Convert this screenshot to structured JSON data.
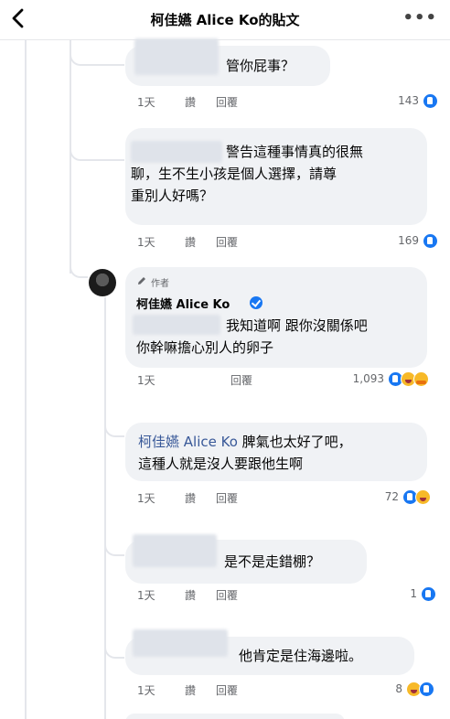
{
  "header": {
    "title": "柯佳嬿 Alice Ko的貼文",
    "more": "•••"
  },
  "actions": {
    "time": "1天",
    "like": "讚",
    "reply": "回覆"
  },
  "author": {
    "tag": "作者",
    "name": "柯佳嬿 Alice Ko"
  },
  "comments": [
    {
      "line1": "管你屁事？",
      "count": "143",
      "reactions": [
        "like"
      ]
    },
    {
      "line1": "警告這種事情真的很無",
      "line2": "聊，生不生小孩是個人選擇，請尊",
      "line3": "重別人好嗎？",
      "count": "169",
      "reactions": [
        "like"
      ]
    },
    {
      "line1": "我知道啊 跟你沒關係吧",
      "line2": "你幹嘛擔心別人的卵子",
      "count": "1,093",
      "reactions": [
        "like",
        "haha",
        "care"
      ]
    },
    {
      "mention": "柯佳嬿 Alice Ko",
      "line1": " 脾氣也太好了吧，",
      "line2": "這種人就是沒人要跟他生啊",
      "count": "72",
      "reactions": [
        "like",
        "haha"
      ]
    },
    {
      "line1": "是不是走錯棚？",
      "count": "1",
      "reactions": [
        "like"
      ]
    },
    {
      "line1": "他肯定是住海邊啦。",
      "count": "8",
      "reactions": [
        "haha",
        "like"
      ]
    }
  ],
  "icons": {
    "back": "back-arrow-icon",
    "more": "more-options-icon",
    "edit": "pencil-icon",
    "verified": "verified-badge-icon"
  },
  "colors": {
    "like": "#1877f2",
    "mention": "#385898",
    "bubble": "#f0f2f5",
    "meta": "#65676b"
  }
}
